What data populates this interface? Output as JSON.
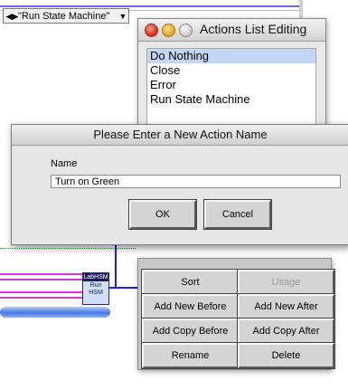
{
  "diagram": {
    "case_selector_value": "\"Run State Machine\"",
    "vi_icon_header": "LabHSM",
    "vi_icon_text": "Run HSM"
  },
  "actions_window": {
    "title": "Actions List Editing",
    "items": [
      {
        "label": "Do Nothing",
        "selected": true
      },
      {
        "label": "Close",
        "selected": false
      },
      {
        "label": "Error",
        "selected": false
      },
      {
        "label": "Run State Machine",
        "selected": false
      }
    ]
  },
  "dialog": {
    "title": "Please Enter a New Action Name",
    "name_label": "Name",
    "name_value": "Turn on Green",
    "ok_label": "OK",
    "cancel_label": "Cancel"
  },
  "panel_buttons": {
    "sort": "Sort",
    "usage": "Usage",
    "add_new_before": "Add New Before",
    "add_new_after": "Add New After",
    "add_copy_before": "Add Copy Before",
    "add_copy_after": "Add Copy After",
    "rename": "Rename",
    "delete": "Delete"
  },
  "colors": {
    "selection": "#c4d6f5",
    "wire_magenta": "#d03ad0",
    "wire_blue": "#1f1fe0"
  }
}
